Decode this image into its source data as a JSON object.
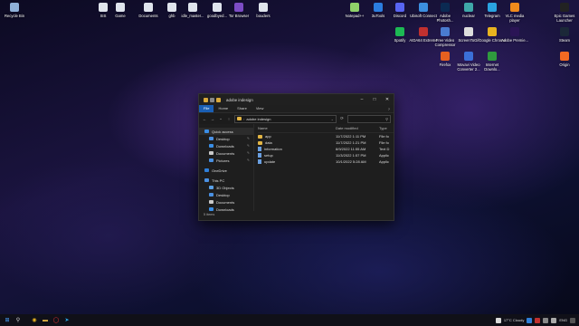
{
  "desktop": {
    "icons_left": [
      {
        "label": "Recycle Bin",
        "icon": "recycle-bin-icon",
        "color": "#8fb0d8"
      },
      {
        "label": "SIS",
        "icon": "file-icon",
        "color": "#dfe4ec"
      },
      {
        "label": "Game",
        "icon": "file-icon",
        "color": "#dfe4ec"
      },
      {
        "label": "Documents",
        "icon": "file-icon",
        "color": "#dfe4ec"
      },
      {
        "label": "ghb",
        "icon": "file-icon",
        "color": "#dfe4ec"
      },
      {
        "label": "idle_master...",
        "icon": "file-icon",
        "color": "#dfe4ec"
      },
      {
        "label": "goodbyed...",
        "icon": "file-icon",
        "color": "#dfe4ec"
      },
      {
        "label": "Tor Browser",
        "icon": "tor-icon",
        "color": "#7c4cc4"
      },
      {
        "label": "bouders",
        "icon": "file-icon",
        "color": "#dfe4ec"
      }
    ],
    "icons_right": [
      {
        "label": "Notepad++",
        "icon": "notepad-icon",
        "color": "#8fd16a"
      },
      {
        "label": "3uTools",
        "icon": "3utools-icon",
        "color": "#2b7de0"
      },
      {
        "label": "Discord",
        "icon": "discord-icon",
        "color": "#5865f2"
      },
      {
        "label": "Ubisoft Connect",
        "icon": "ubisoft-icon",
        "color": "#3c8fe0"
      },
      {
        "label": "Adobe Photosh...",
        "icon": "photoshop-icon",
        "color": "#0b2a52"
      },
      {
        "label": "nuclear",
        "icon": "nuclear-icon",
        "color": "#3fa8a8"
      },
      {
        "label": "Telegram",
        "icon": "telegram-icon",
        "color": "#2aa3e0"
      },
      {
        "label": "VLC media player",
        "icon": "vlc-icon",
        "color": "#f08a1c"
      },
      {
        "label": "Epic Games Launcher",
        "icon": "epic-icon",
        "color": "#222222"
      },
      {
        "label": "Spotify",
        "icon": "spotify-icon",
        "color": "#1db954"
      },
      {
        "label": "AIDA64 Extreme",
        "icon": "aida64-icon",
        "color": "#c0302f"
      },
      {
        "label": "Free Video Compressor",
        "icon": "video-compressor-icon",
        "color": "#4a7bd0"
      },
      {
        "label": "ScreenToGif",
        "icon": "screentogif-icon",
        "color": "#dddddd"
      },
      {
        "label": "Google Chrome",
        "icon": "chrome-icon",
        "color": "#e8b320"
      },
      {
        "label": "Adobe Premie...",
        "icon": "premiere-icon",
        "color": "#2a1455"
      },
      {
        "label": "Steam",
        "icon": "steam-icon",
        "color": "#1b2838"
      },
      {
        "label": "Firefox",
        "icon": "firefox-icon",
        "color": "#e66020"
      },
      {
        "label": "Movavi Video Converter 2...",
        "icon": "movavi-icon",
        "color": "#3b6fd8"
      },
      {
        "label": "Internet Downlo...",
        "icon": "idm-icon",
        "color": "#2f9a3e"
      },
      {
        "label": "Origin",
        "icon": "origin-icon",
        "color": "#f36a22"
      }
    ]
  },
  "explorer": {
    "title": "adobe indesign",
    "ribbon_tabs": [
      "File",
      "Home",
      "Share",
      "View"
    ],
    "address": "adobe indesign",
    "nav": [
      {
        "label": "Quick access",
        "icon": "star-icon",
        "color": "#3a8ee6",
        "pinned": false,
        "selected": true
      },
      {
        "label": "Desktop",
        "icon": "desktop-icon",
        "color": "#4a90e2",
        "pinned": true,
        "selected": false
      },
      {
        "label": "Downloads",
        "icon": "downloads-icon",
        "color": "#3a8ee6",
        "pinned": true,
        "selected": false
      },
      {
        "label": "Documents",
        "icon": "documents-icon",
        "color": "#c9c9c9",
        "pinned": true,
        "selected": false
      },
      {
        "label": "Pictures",
        "icon": "pictures-icon",
        "color": "#4a90e2",
        "pinned": true,
        "selected": false
      },
      {
        "label": "OneDrive",
        "icon": "onedrive-icon",
        "color": "#2f7fd8",
        "pinned": false,
        "selected": false
      },
      {
        "label": "This PC",
        "icon": "this-pc-icon",
        "color": "#4a90e2",
        "pinned": false,
        "selected": false
      },
      {
        "label": "3D Objects",
        "icon": "3d-objects-icon",
        "color": "#5aa0e6",
        "pinned": false,
        "selected": false
      },
      {
        "label": "Desktop",
        "icon": "desktop-icon",
        "color": "#4a90e2",
        "pinned": false,
        "selected": false
      },
      {
        "label": "Documents",
        "icon": "documents-icon",
        "color": "#c9c9c9",
        "pinned": false,
        "selected": false
      },
      {
        "label": "Downloads",
        "icon": "downloads-icon",
        "color": "#3a8ee6",
        "pinned": false,
        "selected": false
      }
    ],
    "columns": {
      "name": "Name",
      "date": "Date modified",
      "type": "Type"
    },
    "files": [
      {
        "name": "app",
        "date": "11/7/2022 1:11 PM",
        "type": "File fo",
        "kind": "folder"
      },
      {
        "name": "data",
        "date": "11/7/2022 1:21 PM",
        "type": "File fo",
        "kind": "folder"
      },
      {
        "name": "information",
        "date": "8/9/2022 11:55 AM",
        "type": "Text D",
        "kind": "file"
      },
      {
        "name": "setup",
        "date": "11/3/2022 1:57 PM",
        "type": "Applic",
        "kind": "file"
      },
      {
        "name": "update",
        "date": "10/1/2022 5:28 AM",
        "type": "Applic",
        "kind": "file"
      }
    ],
    "status": "5 items"
  },
  "taskbar": {
    "apps": [
      {
        "icon": "start-icon",
        "glyph": "⊞",
        "color": "#4aa3ff"
      },
      {
        "icon": "search-icon",
        "glyph": "⚲",
        "color": "#dddddd"
      },
      {
        "icon": "chrome-icon",
        "glyph": "◉",
        "color": "#e8b320"
      },
      {
        "icon": "file-explorer-icon",
        "glyph": "▬",
        "color": "#e2b544"
      },
      {
        "icon": "opera-icon",
        "glyph": "◯",
        "color": "#e33"
      },
      {
        "icon": "telegram-icon",
        "glyph": "➤",
        "color": "#2aa3e0"
      }
    ],
    "weather": "17°C Cloudy",
    "language": "ENG"
  },
  "colors": {
    "accent": "#1a5fb4",
    "folder": "#e2b544"
  }
}
